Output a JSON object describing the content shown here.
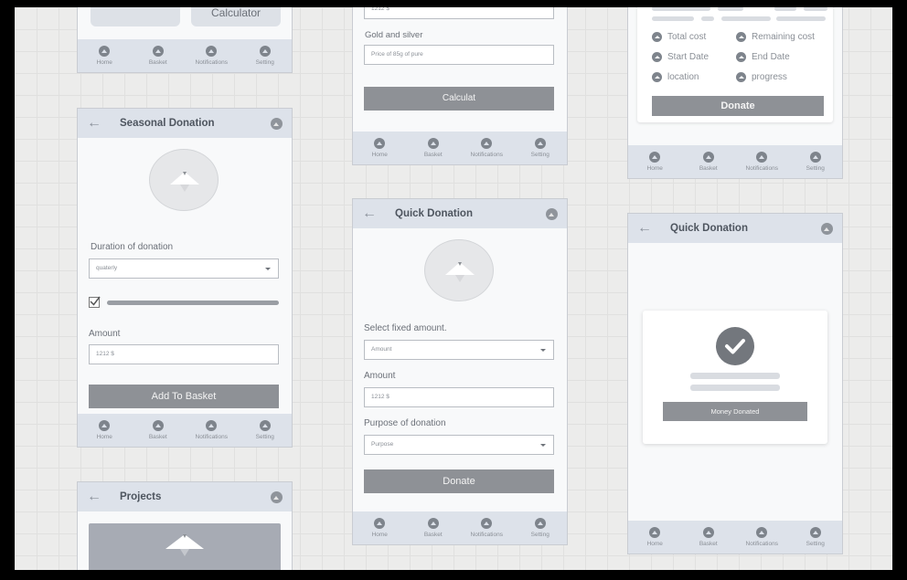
{
  "nav_items": [
    "Home",
    "Basket",
    "Notifications",
    "Setting"
  ],
  "card1": {
    "button_label": "Calculator"
  },
  "card2": {
    "top_value": "1212 $",
    "gold_label": "Gold and silver",
    "gold_placeholder": "Price of 85g of pure",
    "button_label": "Calculat"
  },
  "card3": {
    "meta": [
      "Total cost",
      "Remaining cost",
      "Start Date",
      "End Date",
      "location",
      "progress"
    ],
    "button_label": "Donate"
  },
  "seasonal": {
    "title": "Seasonal Donation",
    "duration_label": "Duration of donation",
    "duration_value": "quaterly",
    "amount_label": "Amount",
    "amount_value": "1212 $",
    "button_label": "Add To Basket"
  },
  "quick": {
    "title": "Quick Donation",
    "fixed_label": "Select fixed amount.",
    "fixed_value": "Amount",
    "amount_label": "Amount",
    "amount_value": "1212 $",
    "purpose_label": "Purpose of donation",
    "purpose_value": "Purpose",
    "button_label": "Donate"
  },
  "quick2": {
    "title": "Quick Donation",
    "button_label": "Money Donated"
  },
  "projects": {
    "title": "Projects"
  }
}
